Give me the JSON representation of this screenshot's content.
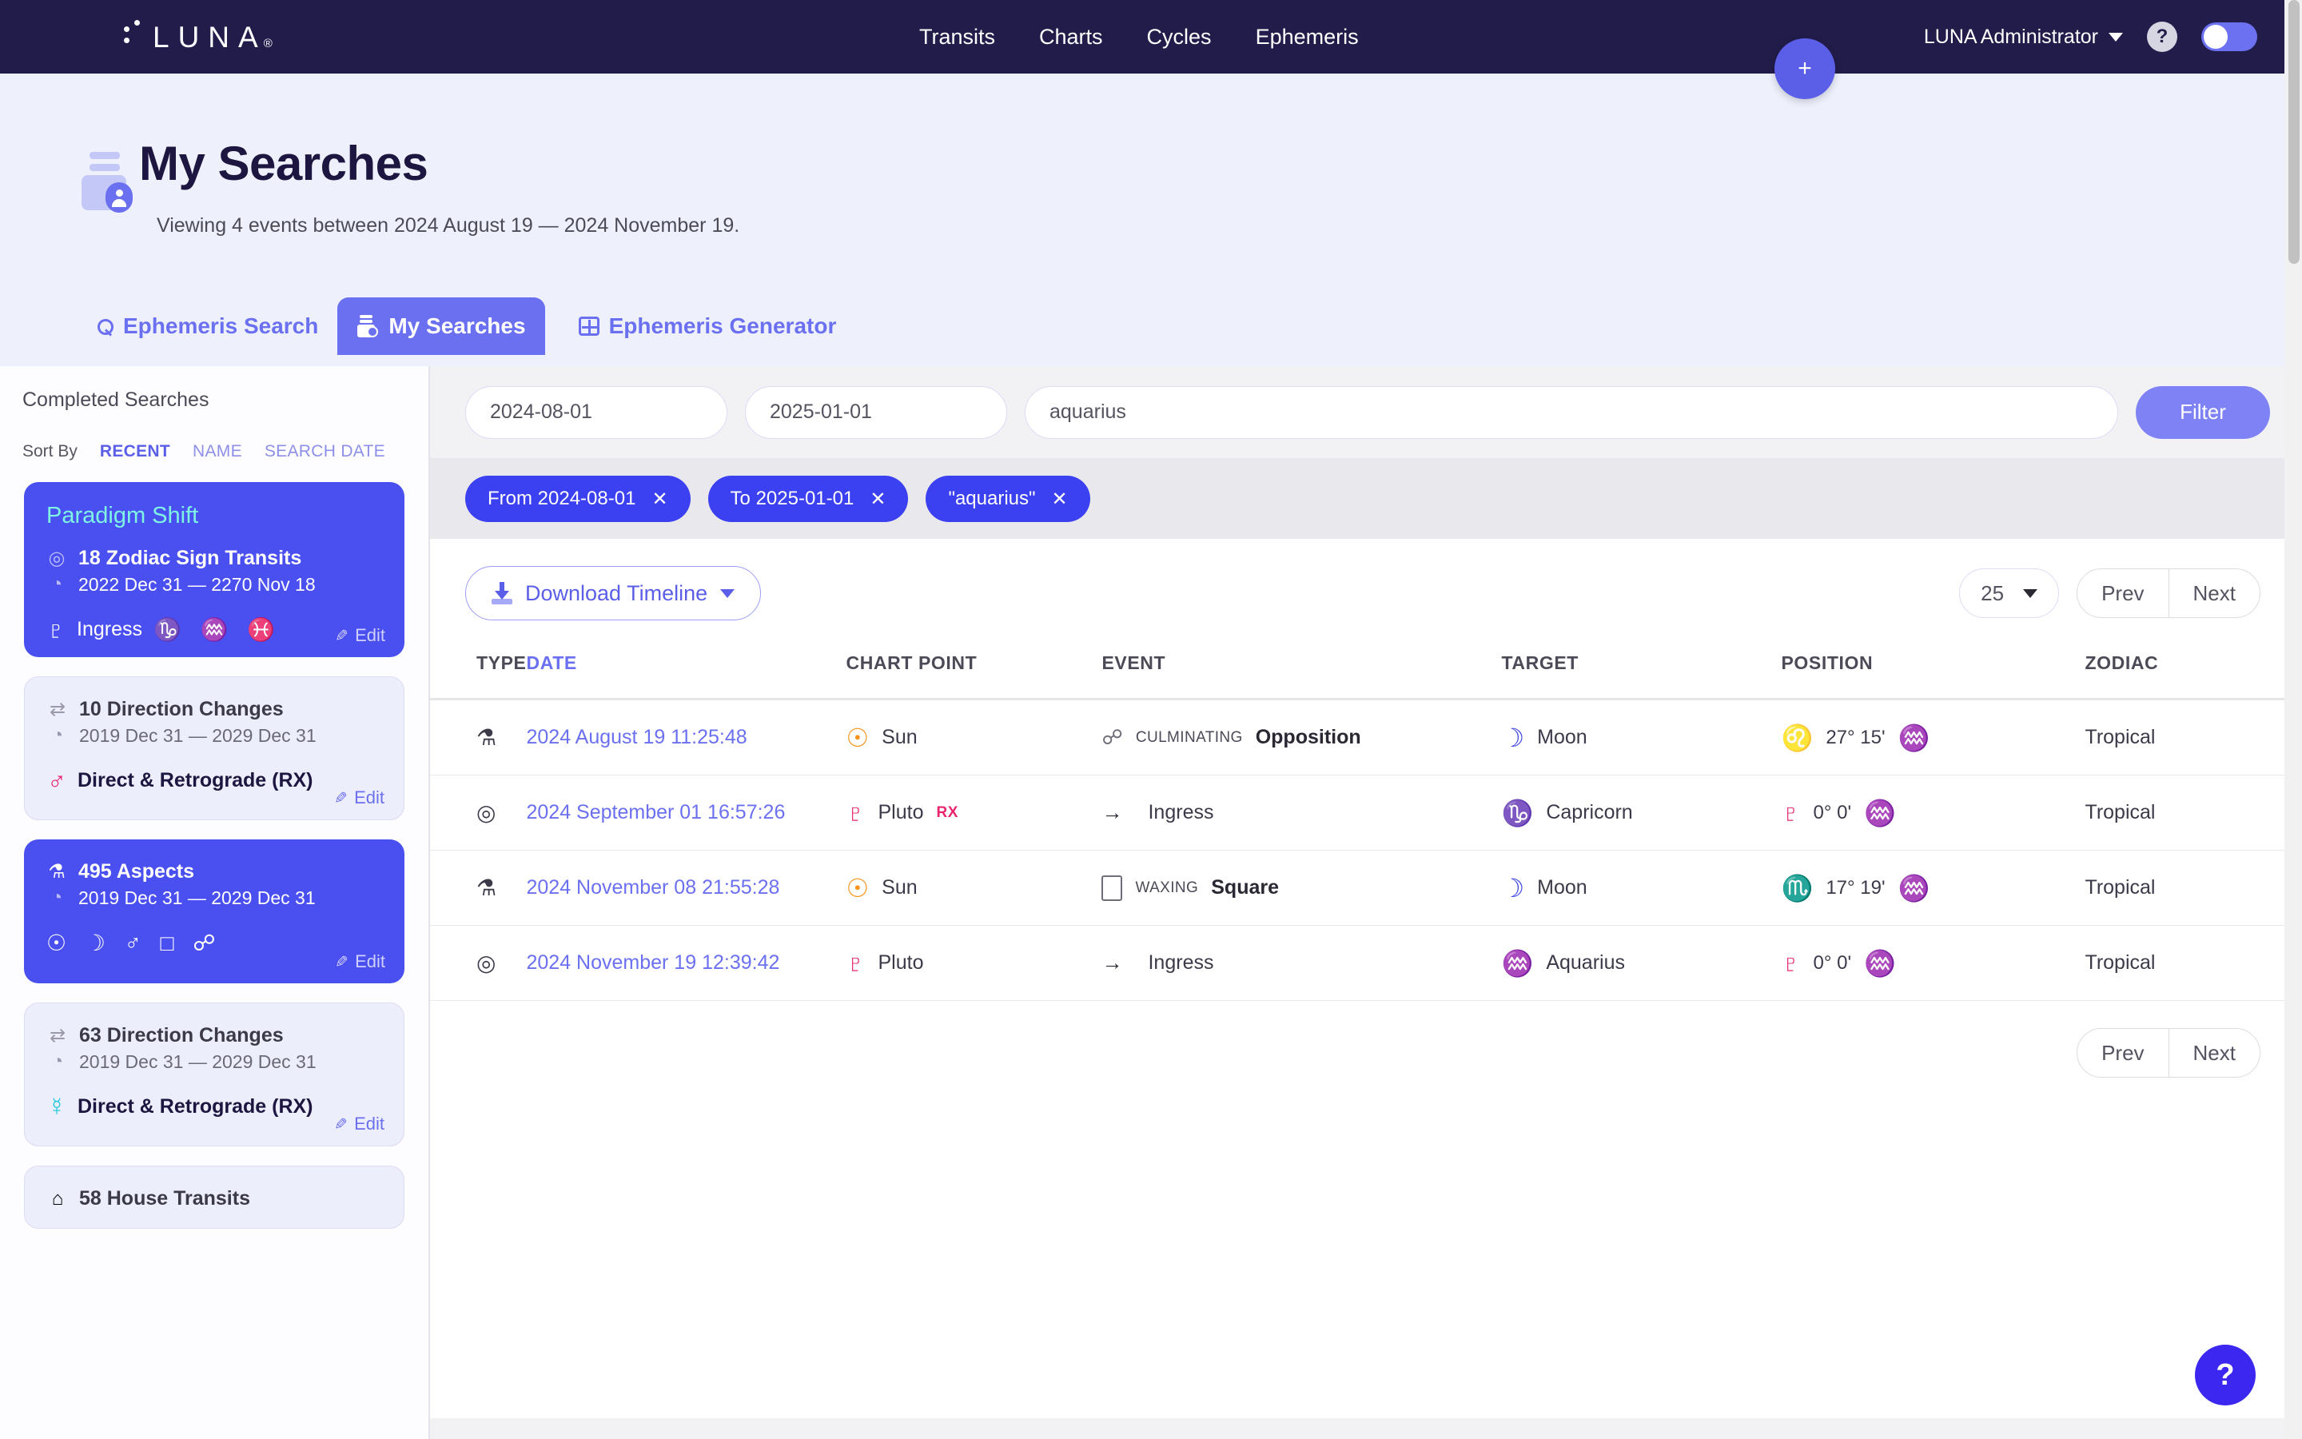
{
  "brand": {
    "name": "LUNA",
    "registered": "®"
  },
  "topnav": {
    "links": [
      "Transits",
      "Charts",
      "Cycles",
      "Ephemeris"
    ],
    "user": "LUNA Administrator",
    "help_label": "?",
    "add_label": "+"
  },
  "header": {
    "title": "My Searches",
    "subtitle": "Viewing 4 events between 2024 August 19 — 2024 November 19."
  },
  "tabs": [
    {
      "label": "Ephemeris Search",
      "icon": "search-icon",
      "active": false
    },
    {
      "label": "My Searches",
      "icon": "archive-icon",
      "active": true
    },
    {
      "label": "Ephemeris Generator",
      "icon": "grid-icon",
      "active": false
    }
  ],
  "sidebar": {
    "title": "Completed Searches",
    "sort_label": "Sort By",
    "sort_options": [
      "RECENT",
      "NAME",
      "SEARCH DATE"
    ],
    "sort_active": "RECENT",
    "edit_label": "Edit",
    "cards": [
      {
        "name": "Paradigm Shift",
        "selected": true,
        "count_label": "18 Zodiac Sign Transits",
        "count_icon": "orbit-icon",
        "dates": "2022 Dec 31 — 2270 Nov 18",
        "body_symbol": "♇",
        "body_label": "Ingress",
        "glyphs": "♑ ♒ ♓"
      },
      {
        "name": "",
        "selected": false,
        "count_label": "10 Direction Changes",
        "count_icon": "swap-icon",
        "dates": "2019 Dec 31 — 2029 Dec 31",
        "body_symbol": "♂",
        "body_label": "Direct & Retrograde (RX)",
        "glyphs": ""
      },
      {
        "name": "",
        "selected": true,
        "count_label": "495 Aspects",
        "count_icon": "compass-icon",
        "dates": "2019 Dec 31 — 2029 Dec 31",
        "body_symbol": "",
        "body_label": "",
        "glyphs": "☉ ☽ ♂ □ ☍"
      },
      {
        "name": "",
        "selected": false,
        "count_label": "63 Direction Changes",
        "count_icon": "swap-icon",
        "dates": "2019 Dec 31 — 2029 Dec 31",
        "body_symbol": "☿",
        "body_label": "Direct & Retrograde (RX)",
        "glyphs": ""
      },
      {
        "name": "",
        "selected": false,
        "count_label": "58 House Transits",
        "count_icon": "house-icon",
        "dates": "",
        "body_symbol": "",
        "body_label": "",
        "glyphs": ""
      }
    ]
  },
  "filters": {
    "date_from": "2024-08-01",
    "date_to": "2025-01-01",
    "search_text": "aquarius",
    "filter_button": "Filter",
    "chips": [
      {
        "label": "From 2024-08-01",
        "remove": "✕"
      },
      {
        "label": "To 2025-01-01",
        "remove": "✕"
      },
      {
        "label": "\"aquarius\"",
        "remove": "✕"
      }
    ]
  },
  "toolbar": {
    "download_label": "Download Timeline",
    "page_size": "25",
    "prev_label": "Prev",
    "next_label": "Next"
  },
  "table": {
    "headers": [
      "TYPE",
      "DATE",
      "CHART POINT",
      "EVENT",
      "TARGET",
      "POSITION",
      "ZODIAC"
    ],
    "rows": [
      {
        "type_icon": "compass-icon",
        "type_glyph": "⚗",
        "date": "2024 August 19 11:25:48",
        "chart_point": "Sun",
        "chart_point_glyph": "☉",
        "chart_point_class": "sun",
        "retrograde": "",
        "event_icon": "opposition-icon",
        "event_glyph": "☍",
        "event_prefix": "CULMINATING",
        "event_name": "Opposition",
        "target": "Moon",
        "target_glyph": "☽",
        "target_class": "moon",
        "position_glyph": "♌",
        "position_class": "leo",
        "position": "27° 15'",
        "position_sign_glyph": "♒",
        "zodiac": "Tropical"
      },
      {
        "type_icon": "orbit-icon",
        "type_glyph": "◎",
        "date": "2024 September 01 16:57:26",
        "chart_point": "Pluto",
        "chart_point_glyph": "♇",
        "chart_point_class": "pluto",
        "retrograde": "RX",
        "event_icon": "arrow-right-icon",
        "event_glyph": "→",
        "event_prefix": "",
        "event_name": "Ingress",
        "target": "Capricorn",
        "target_glyph": "♑",
        "target_class": "cap",
        "position_glyph": "♇",
        "position_class": "pluto",
        "position": "0° 0'",
        "position_sign_glyph": "♒",
        "zodiac": "Tropical"
      },
      {
        "type_icon": "compass-icon",
        "type_glyph": "⚗",
        "date": "2024 November 08 21:55:28",
        "chart_point": "Sun",
        "chart_point_glyph": "☉",
        "chart_point_class": "sun",
        "retrograde": "",
        "event_icon": "square-icon",
        "event_glyph": "□",
        "event_prefix": "WAXING",
        "event_name": "Square",
        "target": "Moon",
        "target_glyph": "☽",
        "target_class": "moon",
        "position_glyph": "♏",
        "position_class": "scorp",
        "position": "17° 19'",
        "position_sign_glyph": "♒",
        "zodiac": "Tropical"
      },
      {
        "type_icon": "orbit-icon",
        "type_glyph": "◎",
        "date": "2024 November 19 12:39:42",
        "chart_point": "Pluto",
        "chart_point_glyph": "♇",
        "chart_point_class": "pluto",
        "retrograde": "",
        "event_icon": "arrow-right-icon",
        "event_glyph": "→",
        "event_prefix": "",
        "event_name": "Ingress",
        "target": "Aquarius",
        "target_glyph": "♒",
        "target_class": "aqua",
        "position_glyph": "♇",
        "position_class": "pluto",
        "position": "0° 0'",
        "position_sign_glyph": "♒",
        "zodiac": "Tropical"
      }
    ]
  },
  "colors": {
    "nav_bg": "#221c4b",
    "accent": "#5b5fe8",
    "accent_light": "#6b70f0",
    "chip": "#3b40f0",
    "card_selected": "#4a4ff0",
    "card_name": "#7ef3e4",
    "sun": "#f7931e",
    "moon": "#3b44e0",
    "pluto": "#e8256e",
    "capricorn": "#9b3f8f",
    "aquarius": "#19c6de"
  },
  "fab": {
    "help": "?"
  }
}
